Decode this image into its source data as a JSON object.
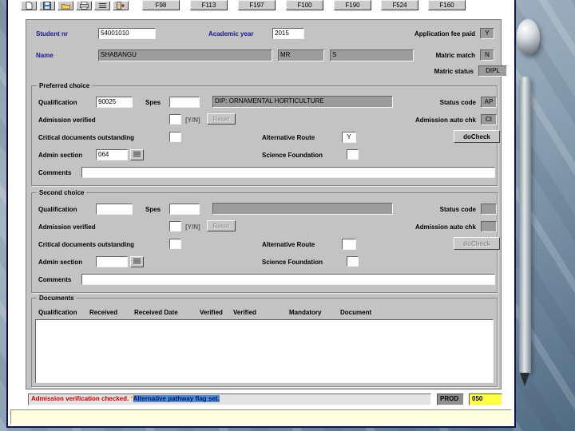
{
  "toolbar": {
    "icons": [
      "new-document",
      "save",
      "open-folder",
      "print",
      "list",
      "exit"
    ],
    "function_buttons": [
      "F98",
      "F113",
      "F197",
      "F100",
      "F190",
      "F524",
      "F160"
    ]
  },
  "header": {
    "student_nr_label": "Student nr",
    "student_nr_value": "54001010",
    "academic_year_label": "Academic year",
    "academic_year_value": "2015",
    "application_fee_label": "Application fee paid",
    "application_fee_value": "Y",
    "name_label": "Name",
    "surname_value": "SHABANGU",
    "title_value": "MR",
    "initials_value": "S",
    "matric_match_label": "Matric match",
    "matric_match_value": "N",
    "matric_status_label": "Matric status",
    "matric_status_value": "DIPL"
  },
  "preferred_choice": {
    "legend": "Preferred choice",
    "qualification_label": "Qualification",
    "qualification_value": "90025",
    "spec_label": "Spes",
    "spec_value": "",
    "description_value": "DIP: ORNAMENTAL HORTICULTURE",
    "status_code_label": "Status code",
    "status_code_value": "AP",
    "admission_verified_label": "Admission verified",
    "admission_verified_value": "",
    "yn_hint": "[Y/N]",
    "reset_label": "Reset",
    "admission_auto_chk_label": "Admission auto chk",
    "admission_auto_chk_value": "CI",
    "critical_docs_label": "Critical documents outstanding",
    "critical_docs_value": "",
    "alternative_route_label": "Alternative Route",
    "alternative_route_value": "Y",
    "docheck_label": "doCheck",
    "admin_section_label": "Admin section",
    "admin_section_value": "064",
    "science_foundation_label": "Science Foundation",
    "science_foundation_value": "",
    "comments_label": "Comments",
    "comments_value": ""
  },
  "second_choice": {
    "legend": "Second choice",
    "qualification_label": "Qualification",
    "qualification_value": "",
    "spec_label": "Spes",
    "spec_value": "",
    "description_value": "",
    "status_code_label": "Status code",
    "status_code_value": "",
    "admission_verified_label": "Admission verified",
    "admission_verified_value": "",
    "yn_hint": "[Y/N]",
    "reset_label": "Reset",
    "admission_auto_chk_label": "Admission auto chk",
    "admission_auto_chk_value": "",
    "critical_docs_label": "Critical documents outstanding",
    "critical_docs_value": "",
    "alternative_route_label": "Alternative Route",
    "alternative_route_value": "",
    "docheck_label": "doCheck",
    "admin_section_label": "Admin section",
    "admin_section_value": "",
    "science_foundation_label": "Science Foundation",
    "science_foundation_value": "",
    "comments_label": "Comments",
    "comments_value": ""
  },
  "documents": {
    "legend": "Documents",
    "headers": [
      "Qualification",
      "Received",
      "Received Date",
      "Verified",
      "Verified",
      "Mandatory",
      "Document"
    ]
  },
  "statusbar": {
    "message_checked": "Admission verification checked.",
    "message_star": "*",
    "message_flag": "Alternative pathway flag set.",
    "environment": "PROD",
    "form_code": "050"
  },
  "colors": {
    "panel_gray": "#c3c3c3",
    "field_dark": "#9c9c9c",
    "status_red": "#ce0000",
    "highlight_blue": "#4f8fd6",
    "code_yellow": "#ffff45"
  }
}
